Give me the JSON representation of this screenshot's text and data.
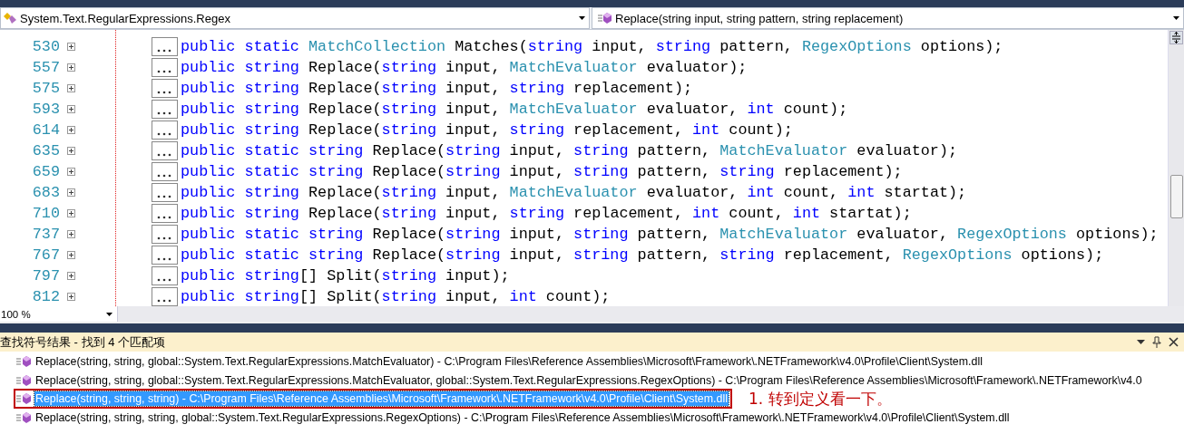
{
  "nav": {
    "type_dropdown": "System.Text.RegularExpressions.Regex",
    "member_dropdown": "Replace(string input, string pattern, string replacement)"
  },
  "code_lines": [
    {
      "number": "530",
      "expanded": false,
      "tokens": [
        {
          "kind": "keyword",
          "text": "public static "
        },
        {
          "kind": "type",
          "text": "MatchCollection"
        },
        {
          "kind": "plain",
          "text": " Matches("
        },
        {
          "kind": "keyword",
          "text": "string"
        },
        {
          "kind": "plain",
          "text": " input, "
        },
        {
          "kind": "keyword",
          "text": "string"
        },
        {
          "kind": "plain",
          "text": " pattern, "
        },
        {
          "kind": "type",
          "text": "RegexOptions"
        },
        {
          "kind": "plain",
          "text": " options);"
        }
      ]
    },
    {
      "number": "557",
      "expanded": false,
      "tokens": [
        {
          "kind": "keyword",
          "text": "public string "
        },
        {
          "kind": "plain",
          "text": "Replace("
        },
        {
          "kind": "keyword",
          "text": "string"
        },
        {
          "kind": "plain",
          "text": " input, "
        },
        {
          "kind": "type",
          "text": "MatchEvaluator"
        },
        {
          "kind": "plain",
          "text": " evaluator);"
        }
      ]
    },
    {
      "number": "575",
      "expanded": false,
      "tokens": [
        {
          "kind": "keyword",
          "text": "public string "
        },
        {
          "kind": "plain",
          "text": "Replace("
        },
        {
          "kind": "keyword",
          "text": "string"
        },
        {
          "kind": "plain",
          "text": " input, "
        },
        {
          "kind": "keyword",
          "text": "string"
        },
        {
          "kind": "plain",
          "text": " replacement);"
        }
      ]
    },
    {
      "number": "593",
      "expanded": false,
      "tokens": [
        {
          "kind": "keyword",
          "text": "public string "
        },
        {
          "kind": "plain",
          "text": "Replace("
        },
        {
          "kind": "keyword",
          "text": "string"
        },
        {
          "kind": "plain",
          "text": " input, "
        },
        {
          "kind": "type",
          "text": "MatchEvaluator"
        },
        {
          "kind": "plain",
          "text": " evaluator, "
        },
        {
          "kind": "keyword",
          "text": "int"
        },
        {
          "kind": "plain",
          "text": " count);"
        }
      ]
    },
    {
      "number": "614",
      "expanded": false,
      "tokens": [
        {
          "kind": "keyword",
          "text": "public string "
        },
        {
          "kind": "plain",
          "text": "Replace("
        },
        {
          "kind": "keyword",
          "text": "string"
        },
        {
          "kind": "plain",
          "text": " input, "
        },
        {
          "kind": "keyword",
          "text": "string"
        },
        {
          "kind": "plain",
          "text": " replacement, "
        },
        {
          "kind": "keyword",
          "text": "int"
        },
        {
          "kind": "plain",
          "text": " count);"
        }
      ]
    },
    {
      "number": "635",
      "expanded": false,
      "tokens": [
        {
          "kind": "keyword",
          "text": "public static string "
        },
        {
          "kind": "plain",
          "text": "Replace("
        },
        {
          "kind": "keyword",
          "text": "string"
        },
        {
          "kind": "plain",
          "text": " input, "
        },
        {
          "kind": "keyword",
          "text": "string"
        },
        {
          "kind": "plain",
          "text": " pattern, "
        },
        {
          "kind": "type",
          "text": "MatchEvaluator"
        },
        {
          "kind": "plain",
          "text": " evaluator);"
        }
      ]
    },
    {
      "number": "659",
      "expanded": false,
      "tokens": [
        {
          "kind": "keyword",
          "text": "public static string "
        },
        {
          "kind": "plain",
          "text": "Replace("
        },
        {
          "kind": "keyword",
          "text": "string"
        },
        {
          "kind": "plain",
          "text": " input, "
        },
        {
          "kind": "keyword",
          "text": "string"
        },
        {
          "kind": "plain",
          "text": " pattern, "
        },
        {
          "kind": "keyword",
          "text": "string"
        },
        {
          "kind": "plain",
          "text": " replacement);"
        }
      ]
    },
    {
      "number": "683",
      "expanded": false,
      "tokens": [
        {
          "kind": "keyword",
          "text": "public string "
        },
        {
          "kind": "plain",
          "text": "Replace("
        },
        {
          "kind": "keyword",
          "text": "string"
        },
        {
          "kind": "plain",
          "text": " input, "
        },
        {
          "kind": "type",
          "text": "MatchEvaluator"
        },
        {
          "kind": "plain",
          "text": " evaluator, "
        },
        {
          "kind": "keyword",
          "text": "int"
        },
        {
          "kind": "plain",
          "text": " count, "
        },
        {
          "kind": "keyword",
          "text": "int"
        },
        {
          "kind": "plain",
          "text": " startat);"
        }
      ]
    },
    {
      "number": "710",
      "expanded": false,
      "tokens": [
        {
          "kind": "keyword",
          "text": "public string "
        },
        {
          "kind": "plain",
          "text": "Replace("
        },
        {
          "kind": "keyword",
          "text": "string"
        },
        {
          "kind": "plain",
          "text": " input, "
        },
        {
          "kind": "keyword",
          "text": "string"
        },
        {
          "kind": "plain",
          "text": " replacement, "
        },
        {
          "kind": "keyword",
          "text": "int"
        },
        {
          "kind": "plain",
          "text": " count, "
        },
        {
          "kind": "keyword",
          "text": "int"
        },
        {
          "kind": "plain",
          "text": " startat);"
        }
      ]
    },
    {
      "number": "737",
      "expanded": false,
      "tokens": [
        {
          "kind": "keyword",
          "text": "public static string "
        },
        {
          "kind": "plain",
          "text": "Replace("
        },
        {
          "kind": "keyword",
          "text": "string"
        },
        {
          "kind": "plain",
          "text": " input, "
        },
        {
          "kind": "keyword",
          "text": "string"
        },
        {
          "kind": "plain",
          "text": " pattern, "
        },
        {
          "kind": "type",
          "text": "MatchEvaluator"
        },
        {
          "kind": "plain",
          "text": " evaluator, "
        },
        {
          "kind": "type",
          "text": "RegexOptions"
        },
        {
          "kind": "plain",
          "text": " options);"
        }
      ]
    },
    {
      "number": "767",
      "expanded": false,
      "tokens": [
        {
          "kind": "keyword",
          "text": "public static string "
        },
        {
          "kind": "plain",
          "text": "Replace("
        },
        {
          "kind": "keyword",
          "text": "string"
        },
        {
          "kind": "plain",
          "text": " input, "
        },
        {
          "kind": "keyword",
          "text": "string"
        },
        {
          "kind": "plain",
          "text": " pattern, "
        },
        {
          "kind": "keyword",
          "text": "string"
        },
        {
          "kind": "plain",
          "text": " replacement, "
        },
        {
          "kind": "type",
          "text": "RegexOptions"
        },
        {
          "kind": "plain",
          "text": " options);"
        }
      ]
    },
    {
      "number": "797",
      "expanded": false,
      "tokens": [
        {
          "kind": "keyword",
          "text": "public string"
        },
        {
          "kind": "plain",
          "text": "[] Split("
        },
        {
          "kind": "keyword",
          "text": "string"
        },
        {
          "kind": "plain",
          "text": " input);"
        }
      ]
    },
    {
      "number": "812",
      "expanded": false,
      "tokens": [
        {
          "kind": "keyword",
          "text": "public string"
        },
        {
          "kind": "plain",
          "text": "[] Split("
        },
        {
          "kind": "keyword",
          "text": "string"
        },
        {
          "kind": "plain",
          "text": " input, "
        },
        {
          "kind": "keyword",
          "text": "int"
        },
        {
          "kind": "plain",
          "text": " count);"
        }
      ]
    }
  ],
  "zoom": "100 %",
  "results": {
    "title": "查找符号结果 - 找到 4 个匹配项",
    "items": [
      {
        "text": "Replace(string, string, global::System.Text.RegularExpressions.MatchEvaluator) - C:\\Program Files\\Reference Assemblies\\Microsoft\\Framework\\.NETFramework\\v4.0\\Profile\\Client\\System.dll",
        "selected": false
      },
      {
        "text": "Replace(string, string, global::System.Text.RegularExpressions.MatchEvaluator, global::System.Text.RegularExpressions.RegexOptions) - C:\\Program Files\\Reference Assemblies\\Microsoft\\Framework\\.NETFramework\\v4.0",
        "selected": false
      },
      {
        "text": "Replace(string, string, string) - C:\\Program Files\\Reference Assemblies\\Microsoft\\Framework\\.NETFramework\\v4.0\\Profile\\Client\\System.dll",
        "selected": true
      },
      {
        "text": "Replace(string, string, string, global::System.Text.RegularExpressions.RegexOptions) - C:\\Program Files\\Reference Assemblies\\Microsoft\\Framework\\.NETFramework\\v4.0\\Profile\\Client\\System.dll",
        "selected": false
      }
    ]
  },
  "annotation": "1. 转到定义看一下。"
}
